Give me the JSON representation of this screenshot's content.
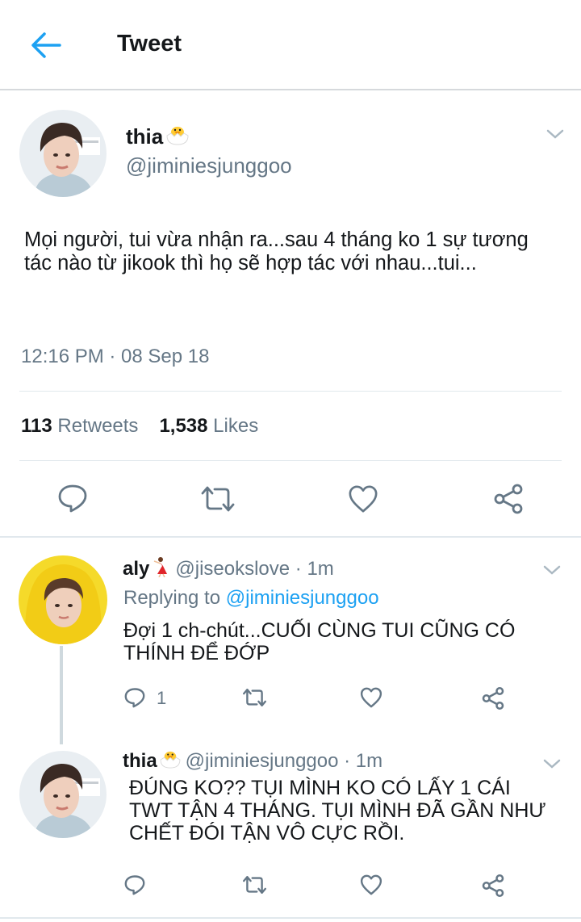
{
  "header": {
    "title": "Tweet"
  },
  "tweet": {
    "display_name": "thia",
    "handle": "@jiminiesjunggoo",
    "text": "Mọi người, tui vừa nhận ra...sau 4 tháng ko 1 sự tương tác nào từ jikook thì họ sẽ hợp tác với nhau...tui...",
    "timestamp": "12:16 PM · 08 Sep 18",
    "retweets_count": "113",
    "retweets_label": "Retweets",
    "likes_count": "1,538",
    "likes_label": "Likes"
  },
  "replies": [
    {
      "display_name": "aly",
      "handle": "@jiseokslove",
      "time": "· 1m",
      "replying_label": "Replying to",
      "replying_to": "@jiminiesjunggoo",
      "text": "Đợi 1 ch-chút...CUỐI CÙNG TUI CŨNG CÓ THÍNH ĐỂ ĐỚP",
      "reply_count": "1"
    },
    {
      "display_name": "thia",
      "handle": "@jiminiesjunggoo",
      "time": "· 1m",
      "text": "ĐÚNG KO?? TỤI MÌNH KO CÓ LẤY 1 CÁI TWT TẬN 4 THÁNG. TỤI MÌNH ĐÃ GẦN NHƯ CHẾT ĐÓI TẬN VÔ CỰC RỒI."
    }
  ],
  "colors": {
    "accent": "#1da1f2",
    "muted": "#657786",
    "text": "#14171a",
    "icon": "#657786"
  }
}
